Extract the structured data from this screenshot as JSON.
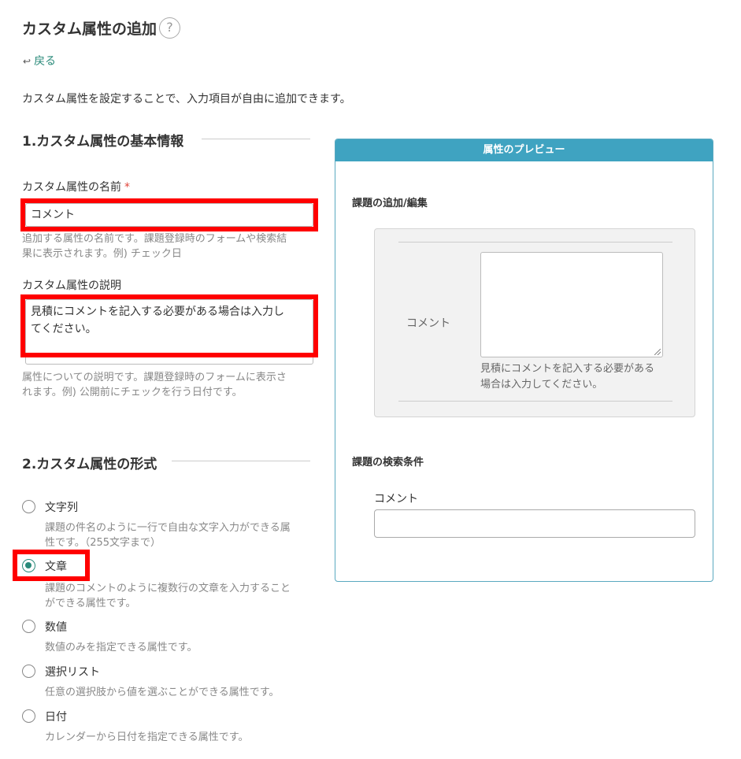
{
  "page": {
    "title": "カスタム属性の追加",
    "help_symbol": "?",
    "back_label": "戻る",
    "back_icon": "↩",
    "intro": "カスタム属性を設定することで、入力項目が自由に追加できます。"
  },
  "section1": {
    "heading": "1.カスタム属性の基本情報",
    "name_label": "カスタム属性の名前",
    "required_mark": "*",
    "name_value": "コメント",
    "name_hint_1": "追加する属性の名前です。課題登録時のフォームや検索結",
    "name_hint_2": "果に表示されます。例) チェック日",
    "desc_label": "カスタム属性の説明",
    "desc_value_1": "見積にコメントを記入する必要がある場合は入力し",
    "desc_value_2": "てください。",
    "desc_hint_1": "属性についての説明です。課題登録時のフォームに表示さ",
    "desc_hint_2": "れます。例) 公開前にチェックを行う日付です。"
  },
  "section2": {
    "heading": "2.カスタム属性の形式",
    "options": [
      {
        "label": "文字列",
        "desc_1": "課題の件名のように一行で自由な文字入力ができる属",
        "desc_2": "性です。（255文字まで）",
        "selected": false
      },
      {
        "label": "文章",
        "desc_1": "課題のコメントのように複数行の文章を入力すること",
        "desc_2": "ができる属性です。",
        "selected": true
      },
      {
        "label": "数値",
        "desc_1": "数値のみを指定できる属性です。",
        "selected": false
      },
      {
        "label": "選択リスト",
        "desc_1": "任意の選択肢から値を選ぶことができる属性です。",
        "selected": false
      },
      {
        "label": "日付",
        "desc_1": "カレンダーから日付を指定できる属性です。",
        "selected": false
      }
    ]
  },
  "preview": {
    "header": "属性のプレビュー",
    "edit_heading": "課題の追加/編集",
    "field_label": "コメント",
    "field_desc_1": "見積にコメントを記入する必要がある",
    "field_desc_2": "場合は入力してください。",
    "search_heading": "課題の検索条件",
    "search_label": "コメント"
  },
  "colors": {
    "accent": "#2a8a7a",
    "panel_header": "#3fa3c1",
    "highlight": "#ff0000",
    "required": "#e0453a"
  }
}
